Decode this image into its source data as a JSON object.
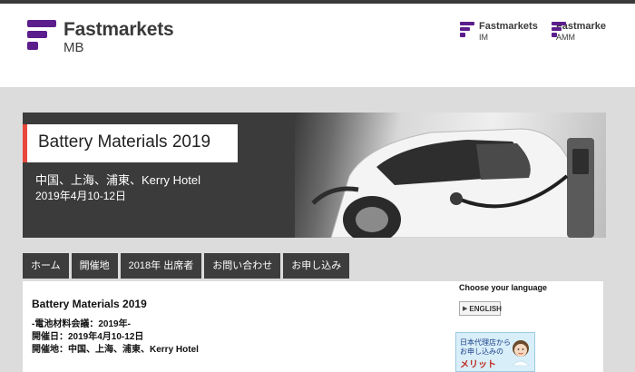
{
  "header": {
    "logo_name": "Fastmarkets",
    "logo_sub": "MB",
    "partner_logos": [
      {
        "name": "Fastmarkets",
        "sub": "IM"
      },
      {
        "name": "Fastmarkets",
        "sub": "AMM"
      }
    ],
    "brand_color": "#5b1e8c"
  },
  "hero": {
    "title": "Battery Materials 2019",
    "location": "中国、上海、浦東、Kerry Hotel",
    "date": "2019年4月10-12日",
    "accent_color": "#e8483b"
  },
  "nav": {
    "items": [
      "ホーム",
      "開催地",
      "2018年 出席者",
      "お問い合わせ",
      "お申し込み"
    ]
  },
  "content": {
    "title": "Battery Materials 2019",
    "lines": [
      "-電池材料会議：2019年-",
      "開催日：2019年4月10-12日",
      "開催地：中国、上海、浦東、Kerry Hotel"
    ]
  },
  "sidebar": {
    "language_label": "Choose your language",
    "language_button": "ENGLISH",
    "agent_banner": {
      "line1": "日本代理店",
      "line1_suffix": "から",
      "line2": "お申し込みの",
      "line3": "メリット"
    }
  }
}
